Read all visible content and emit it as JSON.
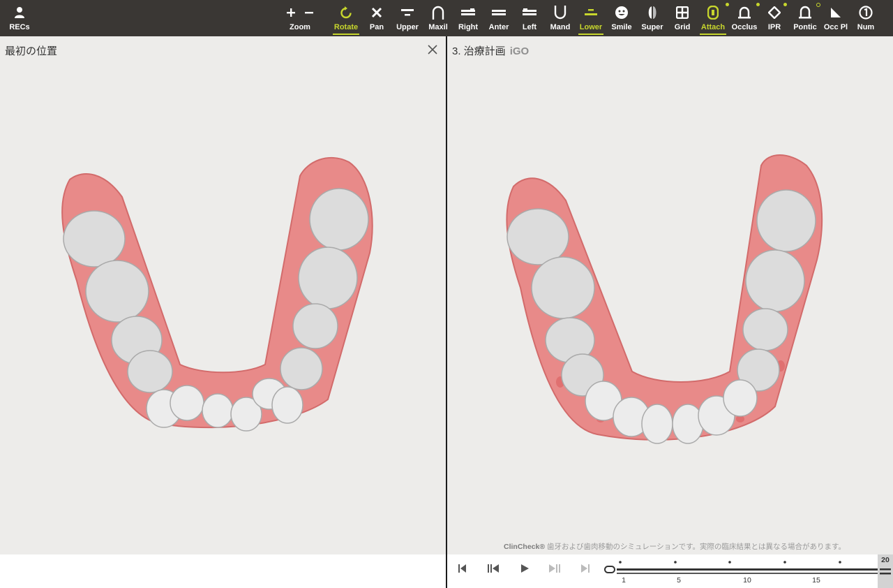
{
  "toolbar": {
    "recs_label": "RECs",
    "zoom_label": "Zoom",
    "rotate_label": "Rotate",
    "pan_label": "Pan",
    "upper_label": "Upper",
    "maxil_label": "Maxil",
    "right_label": "Right",
    "anter_label": "Anter",
    "left_label": "Left",
    "mand_label": "Mand",
    "lower_label": "Lower",
    "smile_label": "Smile",
    "super_label": "Super",
    "grid_label": "Grid",
    "attach_label": "Attach",
    "occlus_label": "Occlus",
    "ipr_label": "IPR",
    "pontic_label": "Pontic",
    "occpl_label": "Occ Pl",
    "num_label": "Num",
    "active": [
      "Rotate",
      "Lower",
      "Attach"
    ],
    "accent_color": "#c7d62d",
    "icons": [
      "user-icon",
      "zoom-in-icon",
      "zoom-out-icon",
      "rotate-icon",
      "pan-icon",
      "upper-icon",
      "maxil-icon",
      "right-icon",
      "anter-icon",
      "left-icon",
      "mand-icon",
      "lower-icon",
      "smile-icon",
      "super-icon",
      "grid-icon",
      "attach-icon",
      "occlus-icon",
      "ipr-icon",
      "pontic-icon",
      "occ-pl-icon",
      "num-icon"
    ]
  },
  "left_panel": {
    "title": "最初の位置"
  },
  "right_panel": {
    "title": "3. 治療計画",
    "subtitle": "iGO",
    "disclaimer_brand": "ClinCheck®",
    "disclaimer_text": " 歯牙および歯肉移動のシミュレーションです。実際の臨床結果とは異なる場合があります。"
  },
  "timeline": {
    "labels": [
      "1",
      "5",
      "10",
      "15"
    ],
    "current_stage": "20"
  }
}
